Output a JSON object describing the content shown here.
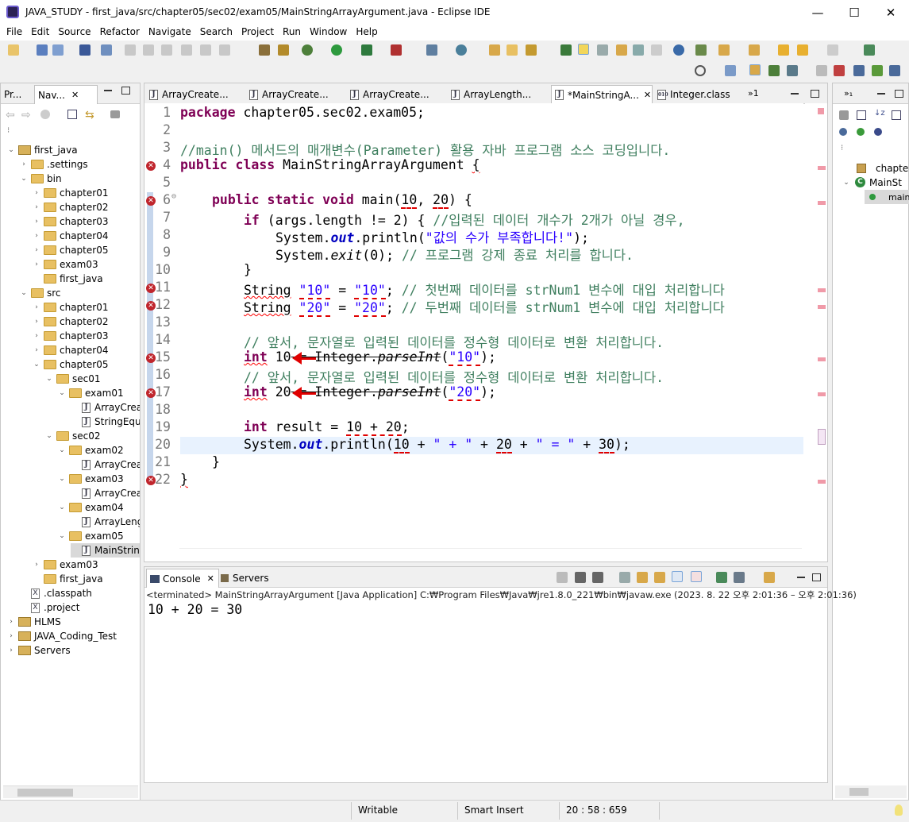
{
  "window": {
    "title": "JAVA_STUDY - first_java/src/chapter05/sec02/exam05/MainStringArrayArgument.java - Eclipse IDE",
    "minimize": "—",
    "maximize": "☐",
    "close": "✕"
  },
  "menu": [
    "File",
    "Edit",
    "Source",
    "Refactor",
    "Navigate",
    "Search",
    "Project",
    "Run",
    "Window",
    "Help"
  ],
  "left_panel": {
    "tabs": [
      "Pr...",
      "Nav..."
    ],
    "tree": [
      {
        "label": "first_java",
        "indent": 0,
        "type": "project",
        "open": true
      },
      {
        "label": ".settings",
        "indent": 1,
        "type": "folder",
        "open": false
      },
      {
        "label": "bin",
        "indent": 1,
        "type": "folder",
        "open": true
      },
      {
        "label": "chapter01",
        "indent": 2,
        "type": "folder",
        "open": false
      },
      {
        "label": "chapter02",
        "indent": 2,
        "type": "folder",
        "open": false
      },
      {
        "label": "chapter03",
        "indent": 2,
        "type": "folder",
        "open": false
      },
      {
        "label": "chapter04",
        "indent": 2,
        "type": "folder",
        "open": false
      },
      {
        "label": "chapter05",
        "indent": 2,
        "type": "folder",
        "open": false
      },
      {
        "label": "exam03",
        "indent": 2,
        "type": "folder",
        "open": false
      },
      {
        "label": "first_java",
        "indent": 2,
        "type": "folder",
        "open": null
      },
      {
        "label": "src",
        "indent": 1,
        "type": "folder",
        "open": true
      },
      {
        "label": "chapter01",
        "indent": 2,
        "type": "folder",
        "open": false
      },
      {
        "label": "chapter02",
        "indent": 2,
        "type": "folder",
        "open": false
      },
      {
        "label": "chapter03",
        "indent": 2,
        "type": "folder",
        "open": false
      },
      {
        "label": "chapter04",
        "indent": 2,
        "type": "folder",
        "open": false
      },
      {
        "label": "chapter05",
        "indent": 2,
        "type": "folder",
        "open": true
      },
      {
        "label": "sec01",
        "indent": 3,
        "type": "folder",
        "open": true
      },
      {
        "label": "exam01",
        "indent": 4,
        "type": "folder",
        "open": true
      },
      {
        "label": "ArrayCrea",
        "indent": 5,
        "type": "java",
        "open": null
      },
      {
        "label": "StringEqu",
        "indent": 5,
        "type": "java",
        "open": null
      },
      {
        "label": "sec02",
        "indent": 3,
        "type": "folder",
        "open": true
      },
      {
        "label": "exam02",
        "indent": 4,
        "type": "folder",
        "open": true
      },
      {
        "label": "ArrayCrea",
        "indent": 5,
        "type": "java",
        "open": null
      },
      {
        "label": "exam03",
        "indent": 4,
        "type": "folder",
        "open": true
      },
      {
        "label": "ArrayCrea",
        "indent": 5,
        "type": "java",
        "open": null
      },
      {
        "label": "exam04",
        "indent": 4,
        "type": "folder",
        "open": true
      },
      {
        "label": "ArrayLeng",
        "indent": 5,
        "type": "java",
        "open": null
      },
      {
        "label": "exam05",
        "indent": 4,
        "type": "folder",
        "open": true
      },
      {
        "label": "MainStrin",
        "indent": 5,
        "type": "java",
        "open": null,
        "selected": true
      },
      {
        "label": "exam03",
        "indent": 2,
        "type": "folder",
        "open": false
      },
      {
        "label": "first_java",
        "indent": 2,
        "type": "folder",
        "open": null
      },
      {
        "label": ".classpath",
        "indent": 1,
        "type": "xfile",
        "open": null
      },
      {
        "label": ".project",
        "indent": 1,
        "type": "xfile",
        "open": null
      },
      {
        "label": "HLMS",
        "indent": 0,
        "type": "project",
        "open": false
      },
      {
        "label": "JAVA_Coding_Test",
        "indent": 0,
        "type": "project",
        "open": false
      },
      {
        "label": "Servers",
        "indent": 0,
        "type": "project",
        "open": false
      }
    ]
  },
  "editor": {
    "tabs": [
      {
        "label": "ArrayCreate...",
        "icon": "J"
      },
      {
        "label": "ArrayCreate...",
        "icon": "J"
      },
      {
        "label": "ArrayCreate...",
        "icon": "J"
      },
      {
        "label": "ArrayLength...",
        "icon": "J"
      },
      {
        "label": "*MainStringA...",
        "icon": "J",
        "active": true
      },
      {
        "label": "Integer.class",
        "icon": "010"
      }
    ],
    "overflow_label": "»1",
    "line_numbers": [
      "1",
      "2",
      "3",
      "4",
      "5",
      "6",
      "7",
      "8",
      "9",
      "10",
      "11",
      "12",
      "13",
      "14",
      "15",
      "16",
      "17",
      "18",
      "19",
      "20",
      "21",
      "22"
    ],
    "code": {
      "l1_kw": "package",
      "l1_rest": " chapter05.sec02.exam05;",
      "l3_comment": "//main() 메서드의 매개변수(Parameter) 활용 자바 프로그램 소스 코딩입니다.",
      "l4_kw": "public class",
      "l4_name": " MainStringArrayArgument ",
      "l4_brace": "{",
      "l6_kw": "public static void",
      "l6_main": " main(",
      "l6_a": "10",
      "l6_comma": ", ",
      "l6_b": "20",
      "l6_end": ") {",
      "l7_kw": "if",
      "l7_rest": " (args.length != 2) { ",
      "l7_comment": "//입력된 데이터 개수가 2개가 아닐 경우,",
      "l8_a": "System.",
      "l8_out": "out",
      "l8_b": ".println(",
      "l8_str": "\"값의 수가 부족합니다!\"",
      "l8_c": ");",
      "l9_a": "System.",
      "l9_exit": "exit",
      "l9_b": "(0); ",
      "l9_comment": "// 프로그램 강제 종료 처리를 합니다.",
      "l10": "}",
      "l11_type": "String",
      "l11_a": " ",
      "l11_s1": "\"10\"",
      "l11_eq": " = ",
      "l11_s2": "\"10\"",
      "l11_end": "; ",
      "l11_comment": "// 첫번째 데이터를 strNum1 변수에 대입 처리합니다",
      "l12_type": "String",
      "l12_a": " ",
      "l12_s1": "\"20\"",
      "l12_eq": " = ",
      "l12_s2": "\"20\"",
      "l12_end": "; ",
      "l12_comment": "// 두번째 데이터를 strNum1 변수에 대입 처리합니다",
      "l14_comment": "// 앞서, 문자열로 입력된 데이터를 정수형 데이터로 변환 처리합니다.",
      "l15_kw": "int",
      "l15_num": " 10",
      "l15_strike": " = Integer.",
      "l15_parse": "parseInt",
      "l15_open": "(",
      "l15_str": "\"10\"",
      "l15_end": ");",
      "l16_comment": "// 앞서, 문자열로 입력된 데이터를 정수형 데이터로 변환 처리합니다.",
      "l17_kw": "int",
      "l17_num": " 20",
      "l17_strike": " = Integer.",
      "l17_parse": "parseInt",
      "l17_open": "(",
      "l17_str": "\"20\"",
      "l17_end": ");",
      "l19_kw": "int",
      "l19_a": " result = ",
      "l19_expr": "10 + 20",
      "l19_end": ";",
      "l20_a": "System.",
      "l20_out": "out",
      "l20_b": ".println(",
      "l20_n1": "10",
      "l20_c": " + ",
      "l20_s1": "\" + \"",
      "l20_d": " + ",
      "l20_n2": "20",
      "l20_e": " + ",
      "l20_s2": "\" = \"",
      "l20_f": " + ",
      "l20_n3": "30",
      "l20_end": ");",
      "l21": "}",
      "l22": "}"
    }
  },
  "outline": {
    "items": [
      "chapter",
      "MainSt",
      "main"
    ]
  },
  "console": {
    "tabs": [
      "Console",
      "Servers"
    ],
    "status": "<terminated> MainStringArrayArgument [Java Application] C:₩Program Files₩Java₩jre1.8.0_221₩bin₩javaw.exe  (2023. 8. 22 오후 2:01:36 – 오후 2:01:36)",
    "output": "10 + 20 = 30"
  },
  "statusbar": {
    "writable": "Writable",
    "insert_mode": "Smart Insert",
    "position": "20 : 58 : 659"
  },
  "colors": {
    "keyword": "#7f0055",
    "comment": "#3f7f5f",
    "string": "#2a00ff",
    "error": "#e00000",
    "current_line": "#e8f2fe"
  }
}
